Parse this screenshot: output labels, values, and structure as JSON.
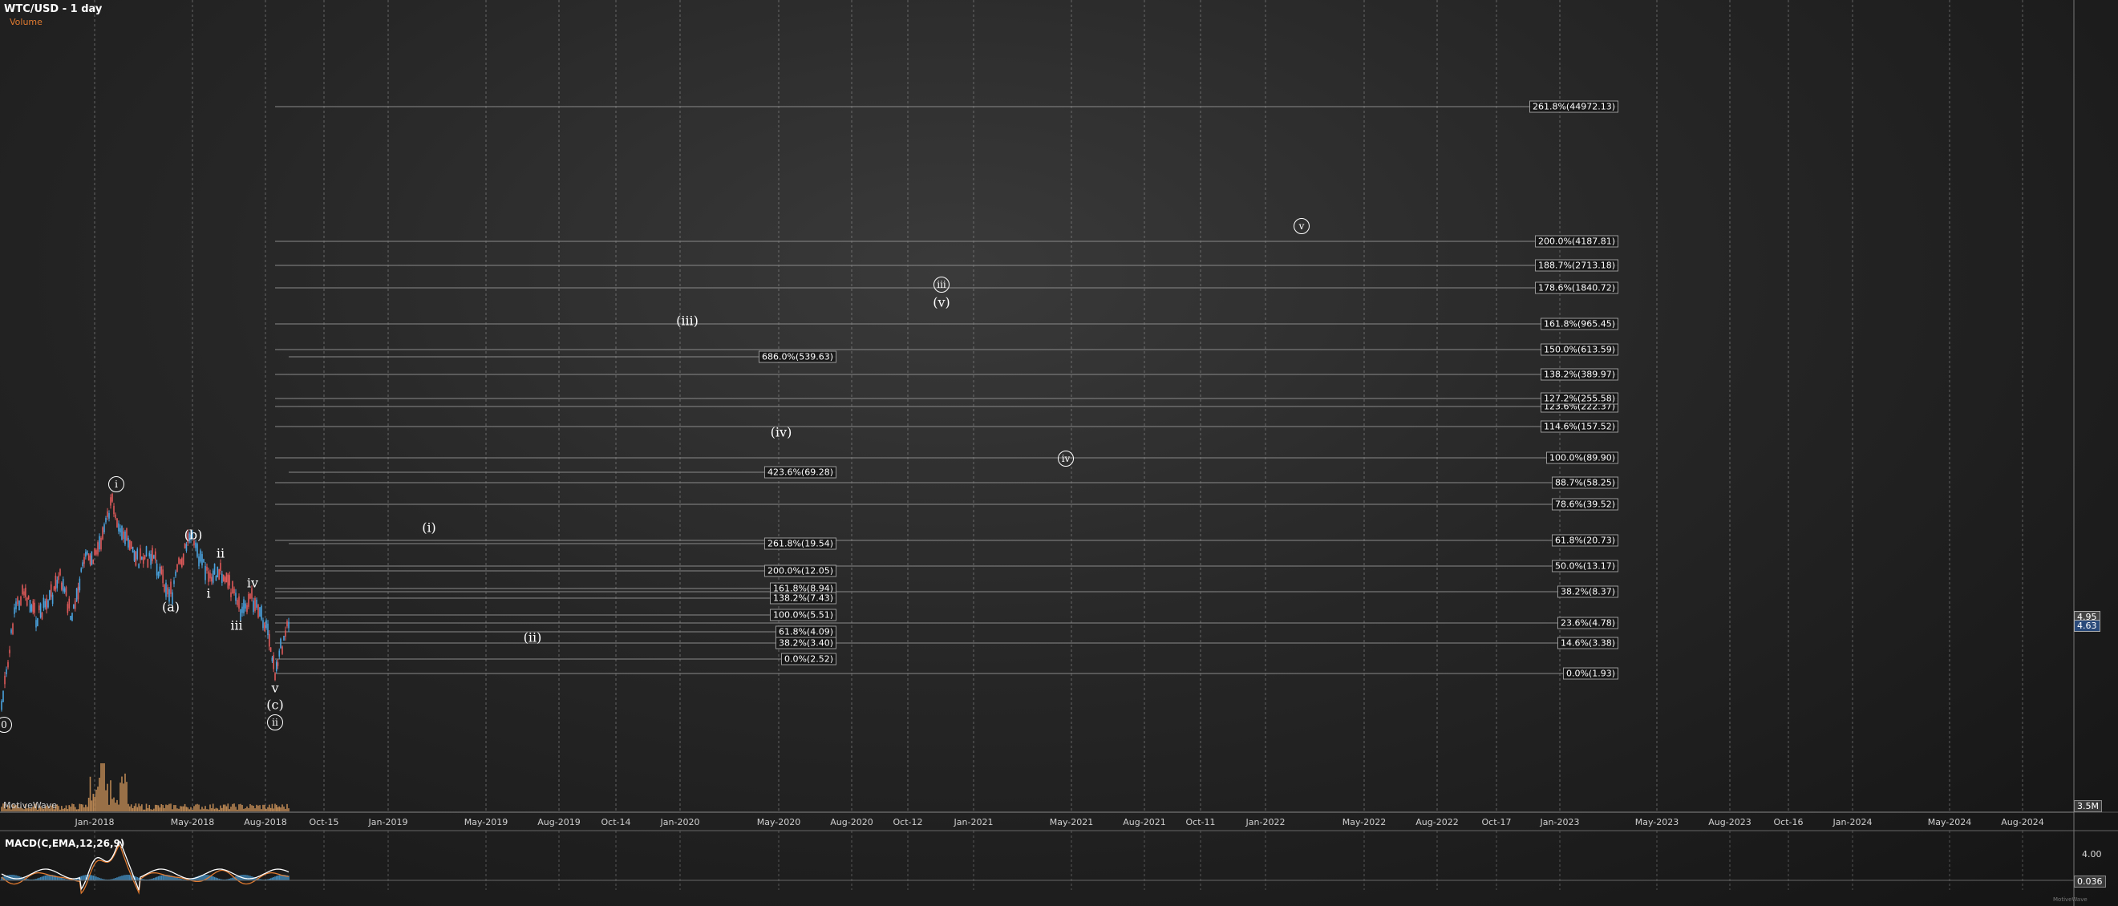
{
  "window": {
    "title": "WTC/USD - 1 day",
    "volume_label": "Volume",
    "motivewave_label": "MotiveWave",
    "volume_axis_value": "3.5M",
    "price_tag_upper": "4.95",
    "price_tag_lower": "4.63",
    "macd_title": "MACD(C,EMA,12,26,9)",
    "macd_axis_top": "4.00",
    "macd_value": "0.036"
  },
  "colors": {
    "up_candle": "#4aa3df",
    "down_candle": "#e05a5a",
    "fib_line": "#8a8a8a",
    "macd_line": "#ffffff",
    "signal_line": "#e07a30",
    "histogram": "#4aa3df",
    "volume_bar": "#e0a060"
  },
  "date_axis": [
    "Jan-2018",
    "May-2018",
    "Aug-2018",
    "Oct-15",
    "Jan-2019",
    "May-2019",
    "Aug-2019",
    "Oct-14",
    "Jan-2020",
    "May-2020",
    "Aug-2020",
    "Oct-12",
    "Jan-2021",
    "May-2021",
    "Aug-2021",
    "Oct-11",
    "Jan-2022",
    "May-2022",
    "Aug-2022",
    "Oct-17",
    "Jan-2023",
    "May-2023",
    "Aug-2023",
    "Oct-16",
    "Jan-2024",
    "May-2024",
    "Aug-2024"
  ],
  "fib_right": [
    "261.8%(44972.13)",
    "200.0%(4187.81)",
    "188.7%(2713.18)",
    "178.6%(1840.72)",
    "161.8%(965.45)",
    "150.0%(613.59)",
    "138.2%(389.97)",
    "127.2%(255.58)",
    "123.6%(222.37)",
    "114.6%(157.52)",
    "100.0%(89.90)",
    "88.7%(58.25)",
    "78.6%(39.52)",
    "61.8%(20.73)",
    "50.0%(13.17)",
    "38.2%(8.37)",
    "23.6%(4.78)",
    "14.6%(3.38)",
    "0.0%(1.93)"
  ],
  "fib_mid": [
    "686.0%(539.63)",
    "423.6%(69.28)",
    "261.8%(19.54)",
    "200.0%(12.05)",
    "161.8%(8.94)",
    "138.2%(7.43)",
    "100.0%(5.51)",
    "61.8%(4.09)",
    "38.2%(3.40)",
    "0.0%(2.52)"
  ],
  "waves": {
    "plain": [
      "(a)",
      "(b)",
      "i",
      "ii",
      "iii",
      "iv",
      "v",
      "(c)",
      "(i)",
      "(ii)",
      "(iii)",
      "(iv)",
      "(v)"
    ],
    "circled": [
      "0",
      "i",
      "ii",
      "iii",
      "iv",
      "v"
    ]
  }
}
